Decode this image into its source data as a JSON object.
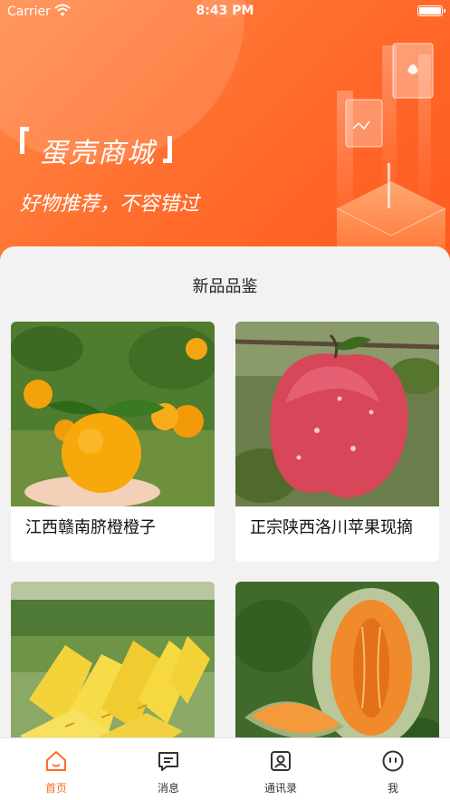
{
  "status_bar": {
    "carrier": "Carrier",
    "time": "8:43 PM"
  },
  "hero": {
    "title": "蛋壳商城",
    "slogan": "好物推荐，不容错过"
  },
  "section": {
    "title": "新品品鉴"
  },
  "products": [
    {
      "name": "江西赣南脐橙橙子",
      "image": "orange-photo"
    },
    {
      "name": "正宗陕西洛川苹果现摘",
      "image": "apple-photo"
    },
    {
      "name": "",
      "image": "pineapple-photo"
    },
    {
      "name": "",
      "image": "melon-photo"
    }
  ],
  "tabbar": {
    "items": [
      {
        "label": "首页",
        "icon": "home-icon",
        "active": true
      },
      {
        "label": "消息",
        "icon": "message-icon",
        "active": false
      },
      {
        "label": "通讯录",
        "icon": "contacts-icon",
        "active": false
      },
      {
        "label": "我",
        "icon": "profile-icon",
        "active": false
      }
    ]
  },
  "colors": {
    "accent": "#ff6a2a",
    "hero_start": "#ff8a48",
    "hero_end": "#ff5a1f"
  }
}
